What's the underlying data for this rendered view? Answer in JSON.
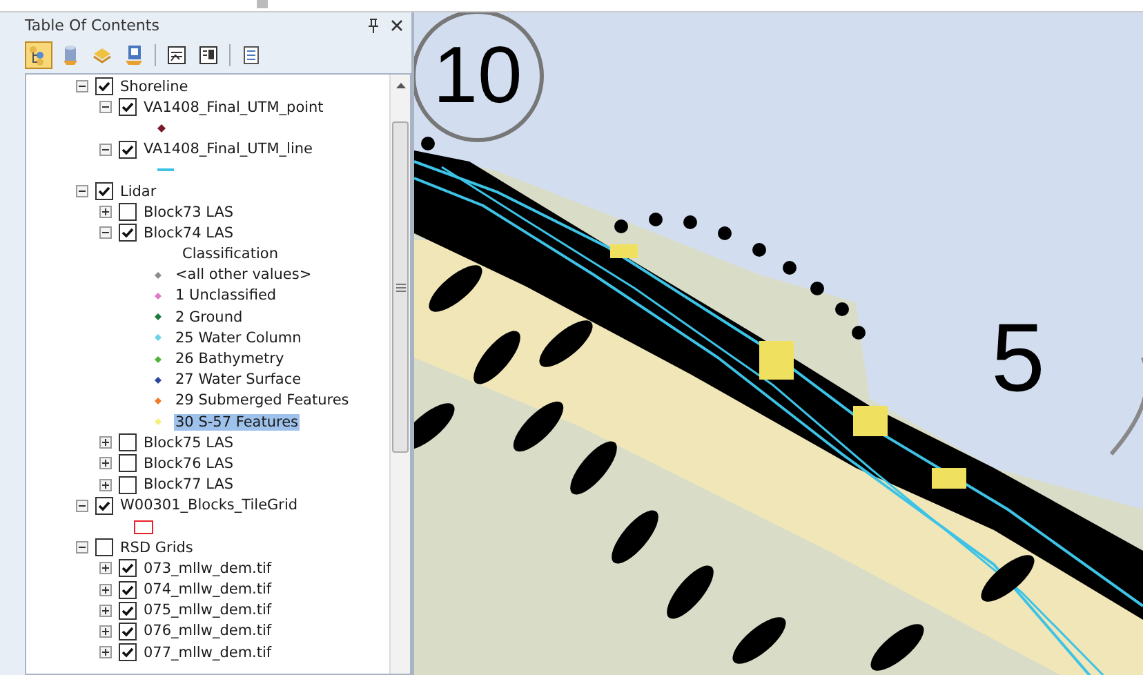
{
  "panel": {
    "title": "Table Of Contents",
    "toolbar": [
      {
        "kind": "tree",
        "selected": true
      },
      {
        "kind": "cylinder",
        "selected": false
      },
      {
        "kind": "stack",
        "selected": false
      },
      {
        "kind": "folder",
        "selected": false
      },
      {
        "kind": "sep"
      },
      {
        "kind": "sheet",
        "selected": false
      },
      {
        "kind": "sheet2",
        "selected": false
      },
      {
        "kind": "sep"
      },
      {
        "kind": "list",
        "selected": false
      }
    ]
  },
  "layers": [
    {
      "name": "Shoreline",
      "checked": true,
      "expanded": true,
      "children": [
        {
          "name": "VA1408_Final_UTM_point",
          "checked": true,
          "expanded": true,
          "legend": [
            {
              "kind": "point",
              "color": "#7a1a2a"
            }
          ]
        },
        {
          "name": "VA1408_Final_UTM_line",
          "checked": true,
          "expanded": true,
          "legend": [
            {
              "kind": "line",
              "color": "#3cc3e6"
            }
          ]
        }
      ]
    },
    {
      "name": "Lidar",
      "checked": true,
      "expanded": true,
      "children": [
        {
          "name": "Block73 LAS",
          "checked": false,
          "expanded": false
        },
        {
          "name": "Block74 LAS",
          "checked": true,
          "expanded": true,
          "legend": [
            {
              "kind": "heading",
              "label": "Classification"
            },
            {
              "kind": "dot",
              "label": "<all other values>",
              "color": "#8c8c8c",
              "selected": false
            },
            {
              "kind": "dot",
              "label": "1 Unclassified",
              "color": "#e07ac8",
              "selected": false
            },
            {
              "kind": "dot",
              "label": "2 Ground",
              "color": "#1a7a3a",
              "selected": false
            },
            {
              "kind": "dot",
              "label": "25 Water Column",
              "color": "#6ad2e6",
              "selected": false
            },
            {
              "kind": "dot",
              "label": "26 Bathymetry",
              "color": "#50b43c",
              "selected": false
            },
            {
              "kind": "dot",
              "label": "27 Water Surface",
              "color": "#2a46a0",
              "selected": false
            },
            {
              "kind": "dot",
              "label": "29 Submerged Features",
              "color": "#f07a28",
              "selected": false
            },
            {
              "kind": "dot",
              "label": "30 S-57 Features",
              "color": "#f5f07a",
              "selected": true
            }
          ]
        },
        {
          "name": "Block75 LAS",
          "checked": false,
          "expanded": false
        },
        {
          "name": "Block76 LAS",
          "checked": false,
          "expanded": false
        },
        {
          "name": "Block77 LAS",
          "checked": false,
          "expanded": false
        }
      ]
    },
    {
      "name": "W00301_Blocks_TileGrid",
      "checked": true,
      "expanded": true,
      "legend": [
        {
          "kind": "outline",
          "color": "#e8202a"
        }
      ]
    },
    {
      "name": "RSD Grids",
      "checked": false,
      "expanded": true,
      "children": [
        {
          "name": "073_mllw_dem.tif",
          "checked": true,
          "expanded": false
        },
        {
          "name": "074_mllw_dem.tif",
          "checked": true,
          "expanded": false
        },
        {
          "name": "075_mllw_dem.tif",
          "checked": true,
          "expanded": false
        },
        {
          "name": "076_mllw_dem.tif",
          "checked": true,
          "expanded": false
        },
        {
          "name": "077_mllw_dem.tif",
          "checked": true,
          "expanded": false
        }
      ]
    }
  ],
  "map": {
    "labels": [
      {
        "text": "10",
        "kind": "circled"
      },
      {
        "text": "5",
        "kind": "plain"
      }
    ]
  }
}
